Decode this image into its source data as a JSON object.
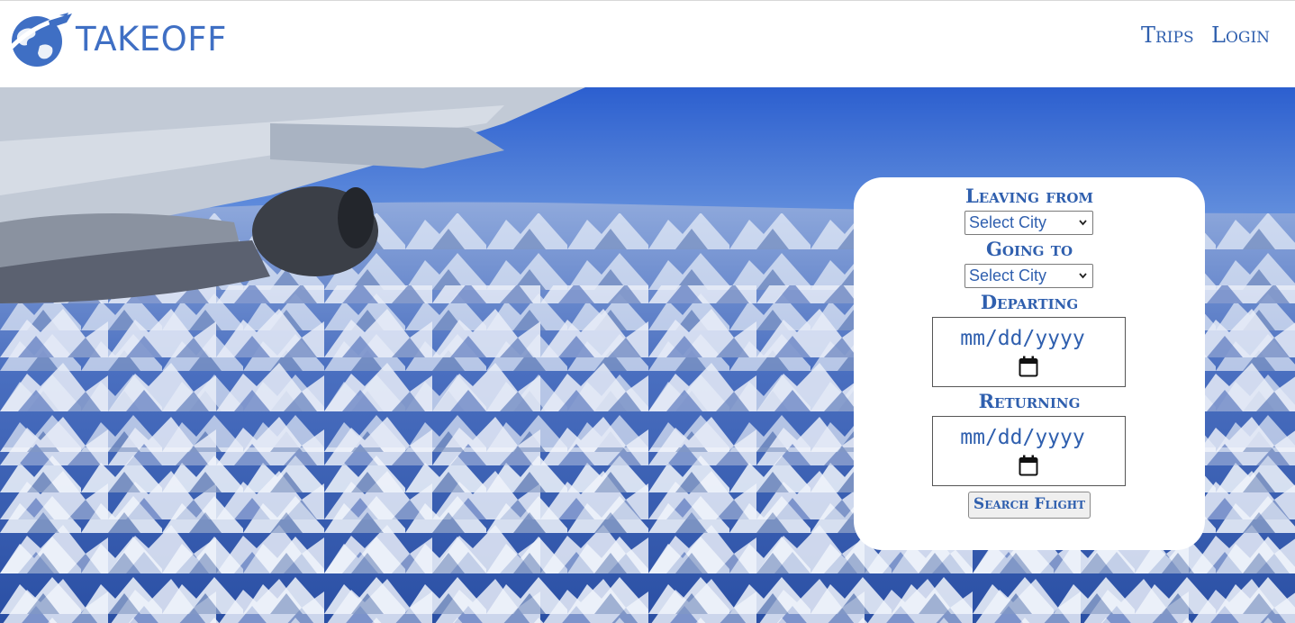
{
  "header": {
    "brand": "TAKEOFF",
    "nav": [
      {
        "label": "Trips"
      },
      {
        "label": "Login"
      }
    ]
  },
  "search_form": {
    "leaving_from": {
      "label": "Leaving from",
      "value": "Select City"
    },
    "going_to": {
      "label": "Going to",
      "value": "Select City"
    },
    "departing": {
      "label": "Departing",
      "placeholder": "mm/dd/yyyy"
    },
    "returning": {
      "label": "Returning",
      "placeholder": "mm/dd/yyyy"
    },
    "submit_label": "Search Flight"
  },
  "icons": {
    "logo": "globe-airplane-logo",
    "select_arrow": "chevron-down-icon",
    "date_picker": "calendar-icon"
  },
  "colors": {
    "brand_blue": "#3f6fc4",
    "label_blue": "#2f5fae",
    "panel_bg": "#ffffff"
  }
}
